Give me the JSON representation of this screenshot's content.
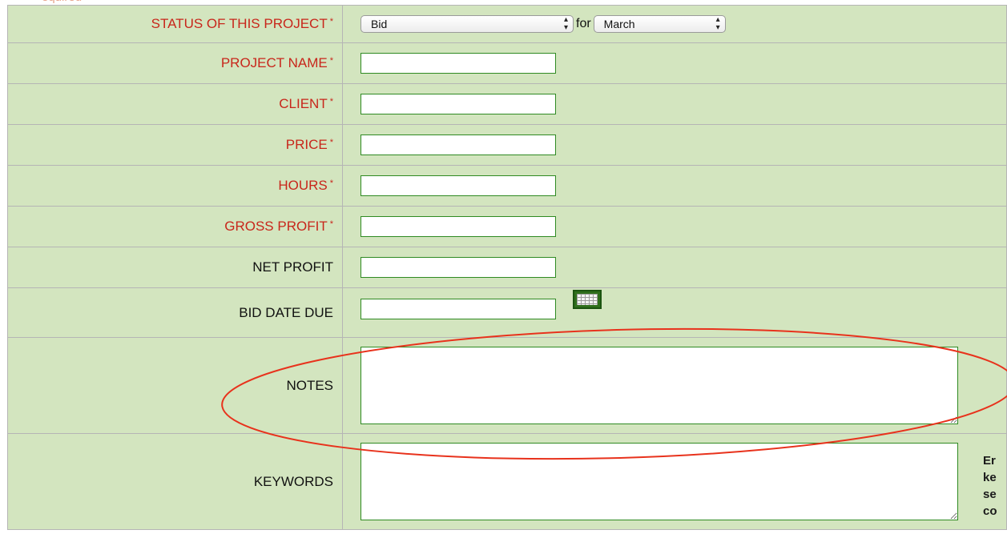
{
  "top_text": "equired",
  "fields": {
    "status": {
      "label": "STATUS OF THIS PROJECT",
      "required_mark": "*",
      "value": "Bid",
      "for_text": "for",
      "month_value": "March"
    },
    "project_name": {
      "label": "PROJECT NAME",
      "required_mark": "*",
      "value": ""
    },
    "client": {
      "label": "CLIENT",
      "required_mark": "*",
      "value": ""
    },
    "price": {
      "label": "PRICE",
      "required_mark": "*",
      "value": ""
    },
    "hours": {
      "label": "HOURS",
      "required_mark": "*",
      "value": ""
    },
    "gross_profit": {
      "label": "GROSS PROFIT",
      "required_mark": "*",
      "value": ""
    },
    "net_profit": {
      "label": "NET PROFIT",
      "value": ""
    },
    "bid_date_due": {
      "label": "BID DATE DUE",
      "value": "",
      "calendar_icon": "calendar-icon"
    },
    "notes": {
      "label": "NOTES",
      "value": ""
    },
    "keywords": {
      "label": "KEYWORDS",
      "value": "",
      "side_text": [
        "Er",
        "ke",
        "se",
        "co"
      ]
    }
  },
  "colors": {
    "form_background": "#d3e5bf",
    "required_label": "#c8261b",
    "input_border": "#2f8a22",
    "annotation_ellipse": "#e8321c"
  },
  "annotation": {
    "shape": "ellipse",
    "highlights": "notes"
  }
}
